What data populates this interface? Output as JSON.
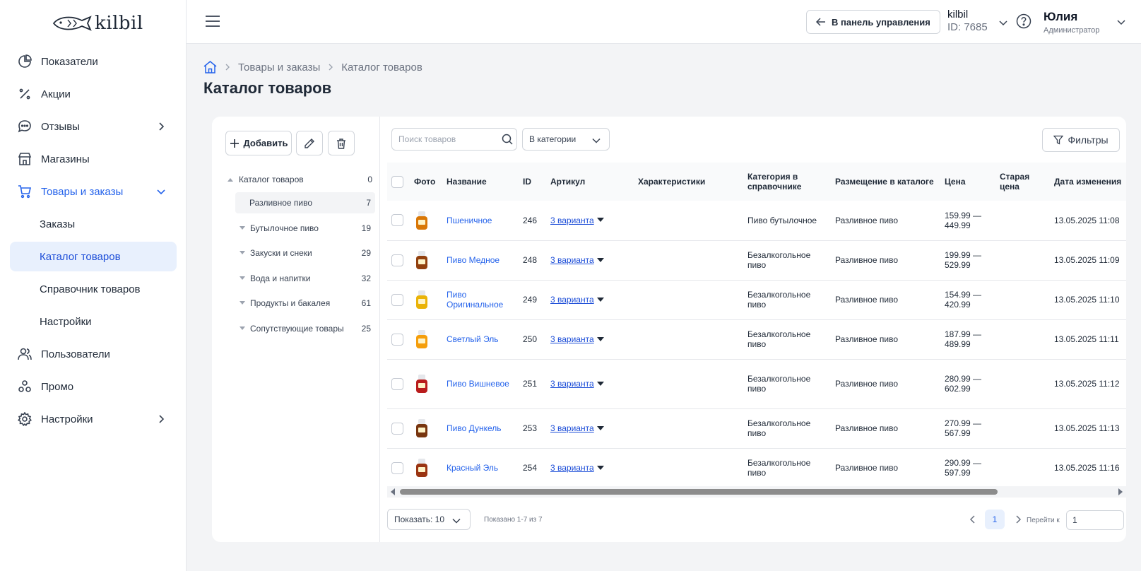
{
  "brand": {
    "logo_text": "kilbil"
  },
  "sidebar": {
    "items": [
      {
        "label": "Показатели",
        "icon": "chart-pie-icon"
      },
      {
        "label": "Акции",
        "icon": "percent-icon"
      },
      {
        "label": "Отзывы",
        "icon": "chat-bubble-icon"
      },
      {
        "label": "Магазины",
        "icon": "store-icon"
      },
      {
        "label": "Товары и заказы",
        "icon": "cart-icon"
      },
      {
        "label": "Заказы"
      },
      {
        "label": "Каталог товаров"
      },
      {
        "label": "Справочник товаров"
      },
      {
        "label": "Настройки"
      },
      {
        "label": "Пользователи",
        "icon": "users-icon"
      },
      {
        "label": "Промо",
        "icon": "promo-icon"
      },
      {
        "label": "Настройки",
        "icon": "gear-icon"
      }
    ]
  },
  "header": {
    "panel_button": "В панель управления",
    "account_name": "kilbil",
    "account_id": "ID: 7685",
    "user_name": "Юлия",
    "user_role": "Администратор"
  },
  "breadcrumb": {
    "items": [
      "Товары и заказы",
      "Каталог товаров"
    ]
  },
  "page": {
    "title": "Каталог товаров"
  },
  "toolbar": {
    "add_label": "Добавить"
  },
  "tree": {
    "root": {
      "label": "Каталог товаров",
      "count": "0"
    },
    "items": [
      {
        "label": "Разливное пиво",
        "count": "7"
      },
      {
        "label": "Бутылочное пиво",
        "count": "19"
      },
      {
        "label": "Закуски и снеки",
        "count": "29"
      },
      {
        "label": "Вода и напитки",
        "count": "32"
      },
      {
        "label": "Продукты и бакалея",
        "count": "61"
      },
      {
        "label": "Сопутствующие товары",
        "count": "25"
      }
    ]
  },
  "search": {
    "placeholder": "Поиск товаров"
  },
  "category_filter": {
    "value": "В категории"
  },
  "filters_button": "Фильтры",
  "table": {
    "columns": [
      "Фото",
      "Название",
      "ID",
      "Артикул",
      "Характеристики",
      "Категория в справочнике",
      "Размещение в каталоге",
      "Цена",
      "Старая цена",
      "Дата изменения"
    ],
    "rows": [
      {
        "name": "Пшеничное",
        "id": "246",
        "article": "3 варианта",
        "category": "Пиво бутылочное",
        "placement": "Разливное пиво",
        "price": "159.99 — 449.99",
        "date": "13.05.2025 11:08",
        "thumb": "#d97706"
      },
      {
        "name": "Пиво Медное",
        "id": "248",
        "article": "3 варианта",
        "category": "Безалкогольное пиво",
        "placement": "Разливное пиво",
        "price": "199.99 — 529.99",
        "date": "13.05.2025 11:09",
        "thumb": "#92400e"
      },
      {
        "name": "Пиво Оригинальное",
        "id": "249",
        "article": "3 варианта",
        "category": "Безалкогольное пиво",
        "placement": "Разливное пиво",
        "price": "154.99 — 420.99",
        "date": "13.05.2025 11:10",
        "thumb": "#eab308"
      },
      {
        "name": "Светлый Эль",
        "id": "250",
        "article": "3 варианта",
        "category": "Безалкогольное пиво",
        "placement": "Разливное пиво",
        "price": "187.99 — 489.99",
        "date": "13.05.2025 11:11",
        "thumb": "#f59e0b"
      },
      {
        "name": "Пиво Вишневое",
        "id": "251",
        "article": "3 варианта",
        "category": "Безалкогольное пиво",
        "placement": "Разливное пиво",
        "price": "280.99 — 602.99",
        "date": "13.05.2025 11:12",
        "thumb": "#b91c1c"
      },
      {
        "name": "Пиво Дункель",
        "id": "253",
        "article": "3 варианта",
        "category": "Безалкогольное пиво",
        "placement": "Разливное пиво",
        "price": "270.99 — 567.99",
        "date": "13.05.2025 11:13",
        "thumb": "#78350f"
      },
      {
        "name": "Красный Эль",
        "id": "254",
        "article": "3 варианта",
        "category": "Безалкогольное пиво",
        "placement": "Разливное пиво",
        "price": "290.99 — 597.99",
        "date": "13.05.2025 11:16",
        "thumb": "#9a3412"
      }
    ]
  },
  "pagination": {
    "page_size": "Показать: 10",
    "shown_text": "Показано 1-7 из 7",
    "current_page": "1",
    "goto_label": "Перейти к",
    "goto_value": "1"
  },
  "colors": {
    "accent": "#2563eb",
    "selected_bg": "#e8f0fd"
  }
}
